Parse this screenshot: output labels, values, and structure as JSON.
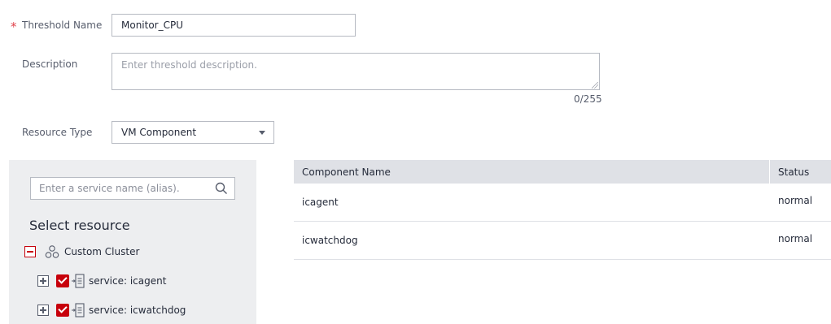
{
  "form": {
    "threshold_name": {
      "required_mark": "*",
      "label": "Threshold Name",
      "value": "Monitor_CPU"
    },
    "description": {
      "label": "Description",
      "placeholder": "Enter threshold description.",
      "counter": "0/255"
    },
    "resource_type": {
      "label": "Resource Type",
      "selected": "VM Component"
    }
  },
  "resource_panel": {
    "search_placeholder": "Enter a service name (alias).",
    "title": "Select resource",
    "tree": {
      "root": {
        "label": "Custom Cluster",
        "expanded": true
      },
      "children": [
        {
          "label": "service: icagent",
          "checked": true
        },
        {
          "label": "service: icwatchdog",
          "checked": true
        }
      ]
    }
  },
  "table": {
    "columns": [
      "Component Name",
      "Status"
    ],
    "rows": [
      {
        "name": "icagent",
        "status": "normal"
      },
      {
        "name": "icwatchdog",
        "status": "normal"
      }
    ]
  },
  "colors": {
    "accent": "#c7000b",
    "required": "#e0424b",
    "header_bg": "#dfe1e6",
    "panel_bg": "#edeef0"
  }
}
